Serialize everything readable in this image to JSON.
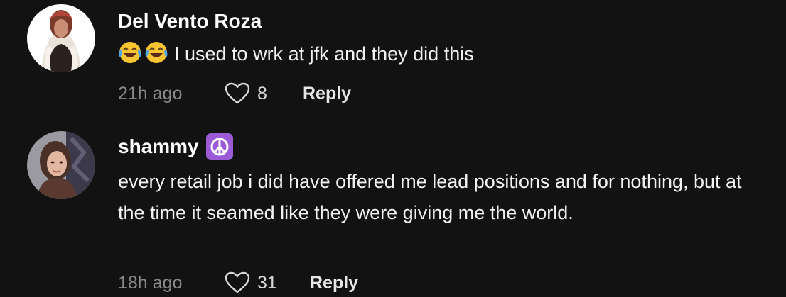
{
  "comments": [
    {
      "username": "Del Vento Roza",
      "text": "I used to wrk at jfk and they did this",
      "emojis": [
        "joy-emoji",
        "joy-emoji"
      ],
      "time": "21h ago",
      "likes": "8",
      "reply_label": "Reply"
    },
    {
      "username": "shammy",
      "username_emoji": "peace-symbol-emoji",
      "text": "every retail job i did have offered me lead positions and for nothing, but at the time it seamed like they were giving me the world.",
      "time": "18h ago",
      "likes": "31",
      "reply_label": "Reply"
    }
  ],
  "colors": {
    "background": "#121212",
    "username": "#ffffff",
    "meta": "#8a8a8a",
    "peace_bg": "#9b5bd6"
  }
}
